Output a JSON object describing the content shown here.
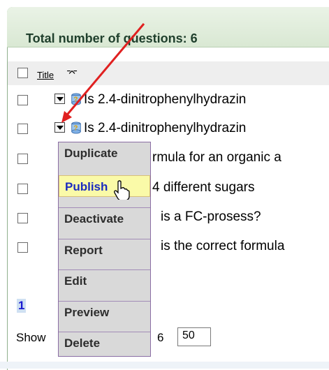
{
  "header": {
    "title": "Total number of questions: 6"
  },
  "columns": {
    "title_label": "Title"
  },
  "rows": [
    {
      "text": "Is 2.4-dinitrophenylhydrazin"
    },
    {
      "text": "Is 2.4-dinitrophenylhydrazin"
    },
    {
      "text": "rmula for an organic a"
    },
    {
      "text": "4 different sugars"
    },
    {
      "text": "is a FC-prosess?"
    },
    {
      "text": "is the correct formula"
    }
  ],
  "menu": {
    "items": [
      {
        "label": "Duplicate"
      },
      {
        "label": "Publish"
      },
      {
        "label": "Deactivate"
      },
      {
        "label": "Report"
      },
      {
        "label": "Edit"
      },
      {
        "label": "Preview"
      },
      {
        "label": "Delete"
      }
    ],
    "highlighted": "Publish"
  },
  "pager": {
    "current_page": "1"
  },
  "footer": {
    "show_label": "Show",
    "count_label": "6",
    "per_page": "50"
  },
  "colors": {
    "accent_arrow": "#e02020",
    "header_bg": "#dbe9d5",
    "menu_highlight": "#fafaa8"
  }
}
